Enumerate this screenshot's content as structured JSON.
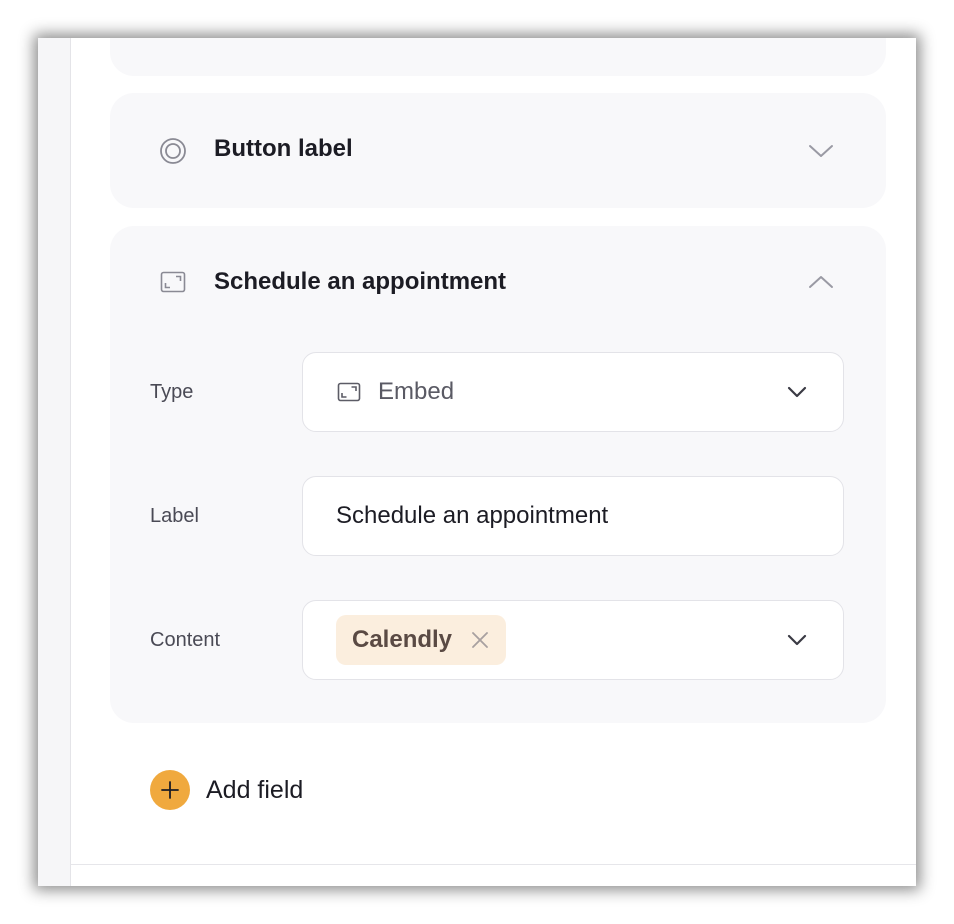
{
  "panel": {
    "sections": [
      {
        "title": "Button label",
        "icon": "radio-target-icon",
        "state": "collapsed"
      },
      {
        "title": "Schedule an appointment",
        "icon": "embed-frame-icon",
        "state": "expanded",
        "fields": {
          "type": {
            "label": "Type",
            "value": "Embed",
            "icon": "embed-frame-icon"
          },
          "label": {
            "label": "Label",
            "value": "Schedule an appointment"
          },
          "content": {
            "label": "Content",
            "chips": [
              "Calendly"
            ]
          }
        }
      }
    ],
    "add_field_label": "Add field"
  },
  "colors": {
    "accent": "#f0a93e",
    "chip_bg": "#fbeede",
    "card_bg": "#f8f8fa",
    "text": "#1c1c24"
  }
}
